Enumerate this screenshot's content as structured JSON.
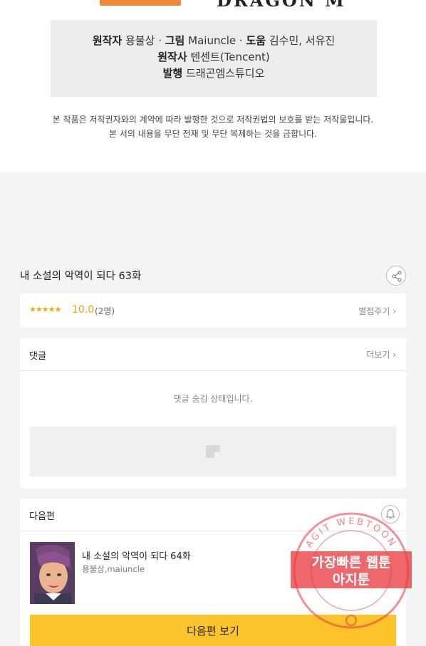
{
  "credits": {
    "author_label": "원작자",
    "author": "용불상",
    "art_label": "그림",
    "art": "Maiuncle",
    "assist_label": "도움",
    "assist": "김수민, 서유진",
    "origin_label": "원작사",
    "origin": "텐센트(Tencent)",
    "publisher_label": "발행",
    "publisher": "드래곤엠스튜디오",
    "sep": "·"
  },
  "logo_right_text": "DRAGON M",
  "notice": {
    "line1": "본 작품은 저작권자와의 계약에 따라 발행한 것으로 저작권법의 보호를 받는 저작물입니다.",
    "line2": "본 서의 내용을 무단 전재 및 무단 복제하는 것을 금합니다."
  },
  "episode": {
    "title": "내 소설의 악역이 되다 63화"
  },
  "rating": {
    "stars": "★★★★★",
    "score": "10.0",
    "count": "(2명)",
    "rate_link": "별점주기 ›"
  },
  "comments": {
    "header": "댓글",
    "more": "더보기 ›",
    "hidden_notice": "댓글 숨김 상태입니다."
  },
  "next": {
    "header": "다음편",
    "title": "내 소설의 악역이 되다 64화",
    "authors": "용불상,maiuncle",
    "button": "다음편 보기"
  },
  "stamp": {
    "arc_text": "AGIT WEBTOON",
    "line1": "가장빠른 웹툰",
    "line2": "아지툰"
  },
  "colors": {
    "accent": "#fcc42b",
    "star": "#f5a800",
    "stamp": "#e8353a"
  }
}
